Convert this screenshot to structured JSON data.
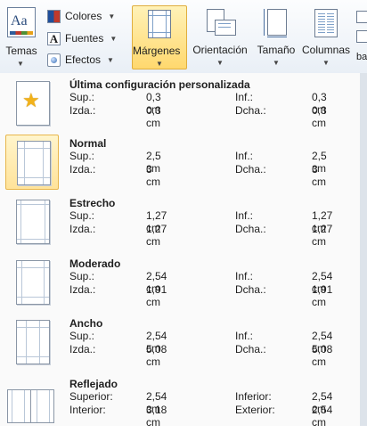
{
  "ribbon": {
    "temas_label": "Temas",
    "colores_label": "Colores",
    "fuentes_label": "Fuentes",
    "efectos_label": "Efectos",
    "margenes_label": "Márgenes",
    "orientacion_label": "Orientación",
    "tamano_label": "Tamaño",
    "columnas_label": "Columnas",
    "theme_icon_text": "Aa",
    "partial_label": "ba"
  },
  "margins": {
    "items": [
      {
        "title": "Última configuración personalizada",
        "icon": "star-page-icon",
        "labels": [
          "Sup.:",
          "Izda.:",
          "Inf.:",
          "Dcha.:"
        ],
        "values": [
          "0,3 cm",
          "0,3 cm",
          "0,3 cm",
          "0,3 cm"
        ]
      },
      {
        "title": "Normal",
        "icon": "normal-page-icon",
        "selected": true,
        "labels": [
          "Sup.:",
          "Izda.:",
          "Inf.:",
          "Dcha.:"
        ],
        "values": [
          "2,5 cm",
          "3 cm",
          "2,5 cm",
          "3 cm"
        ]
      },
      {
        "title": "Estrecho",
        "icon": "narrow-page-icon",
        "labels": [
          "Sup.:",
          "Izda.:",
          "Inf.:",
          "Dcha.:"
        ],
        "values": [
          "1,27 cm",
          "1,27 cm",
          "1,27 cm",
          "1,27 cm"
        ]
      },
      {
        "title": "Moderado",
        "icon": "moderate-page-icon",
        "labels": [
          "Sup.:",
          "Izda.:",
          "Inf.:",
          "Dcha.:"
        ],
        "values": [
          "2,54 cm",
          "1,91 cm",
          "2,54 cm",
          "1,91 cm"
        ]
      },
      {
        "title": "Ancho",
        "icon": "wide-page-icon",
        "labels": [
          "Sup.:",
          "Izda.:",
          "Inf.:",
          "Dcha.:"
        ],
        "values": [
          "2,54 cm",
          "5,08 cm",
          "2,54 cm",
          "5,08 cm"
        ]
      },
      {
        "title": "Reflejado",
        "icon": "mirrored-page-icon",
        "labels": [
          "Superior:",
          "Interior:",
          "Inferior:",
          "Exterior:"
        ],
        "values": [
          "2,54 cm",
          "3,18 cm",
          "2,54 cm",
          "2,54 cm"
        ]
      }
    ]
  },
  "colors": {
    "selection_fill": "#ffd86e",
    "selection_border": "#e0ae3f",
    "ribbon_bg": "#e9eff6",
    "star": "#f2b21a"
  }
}
